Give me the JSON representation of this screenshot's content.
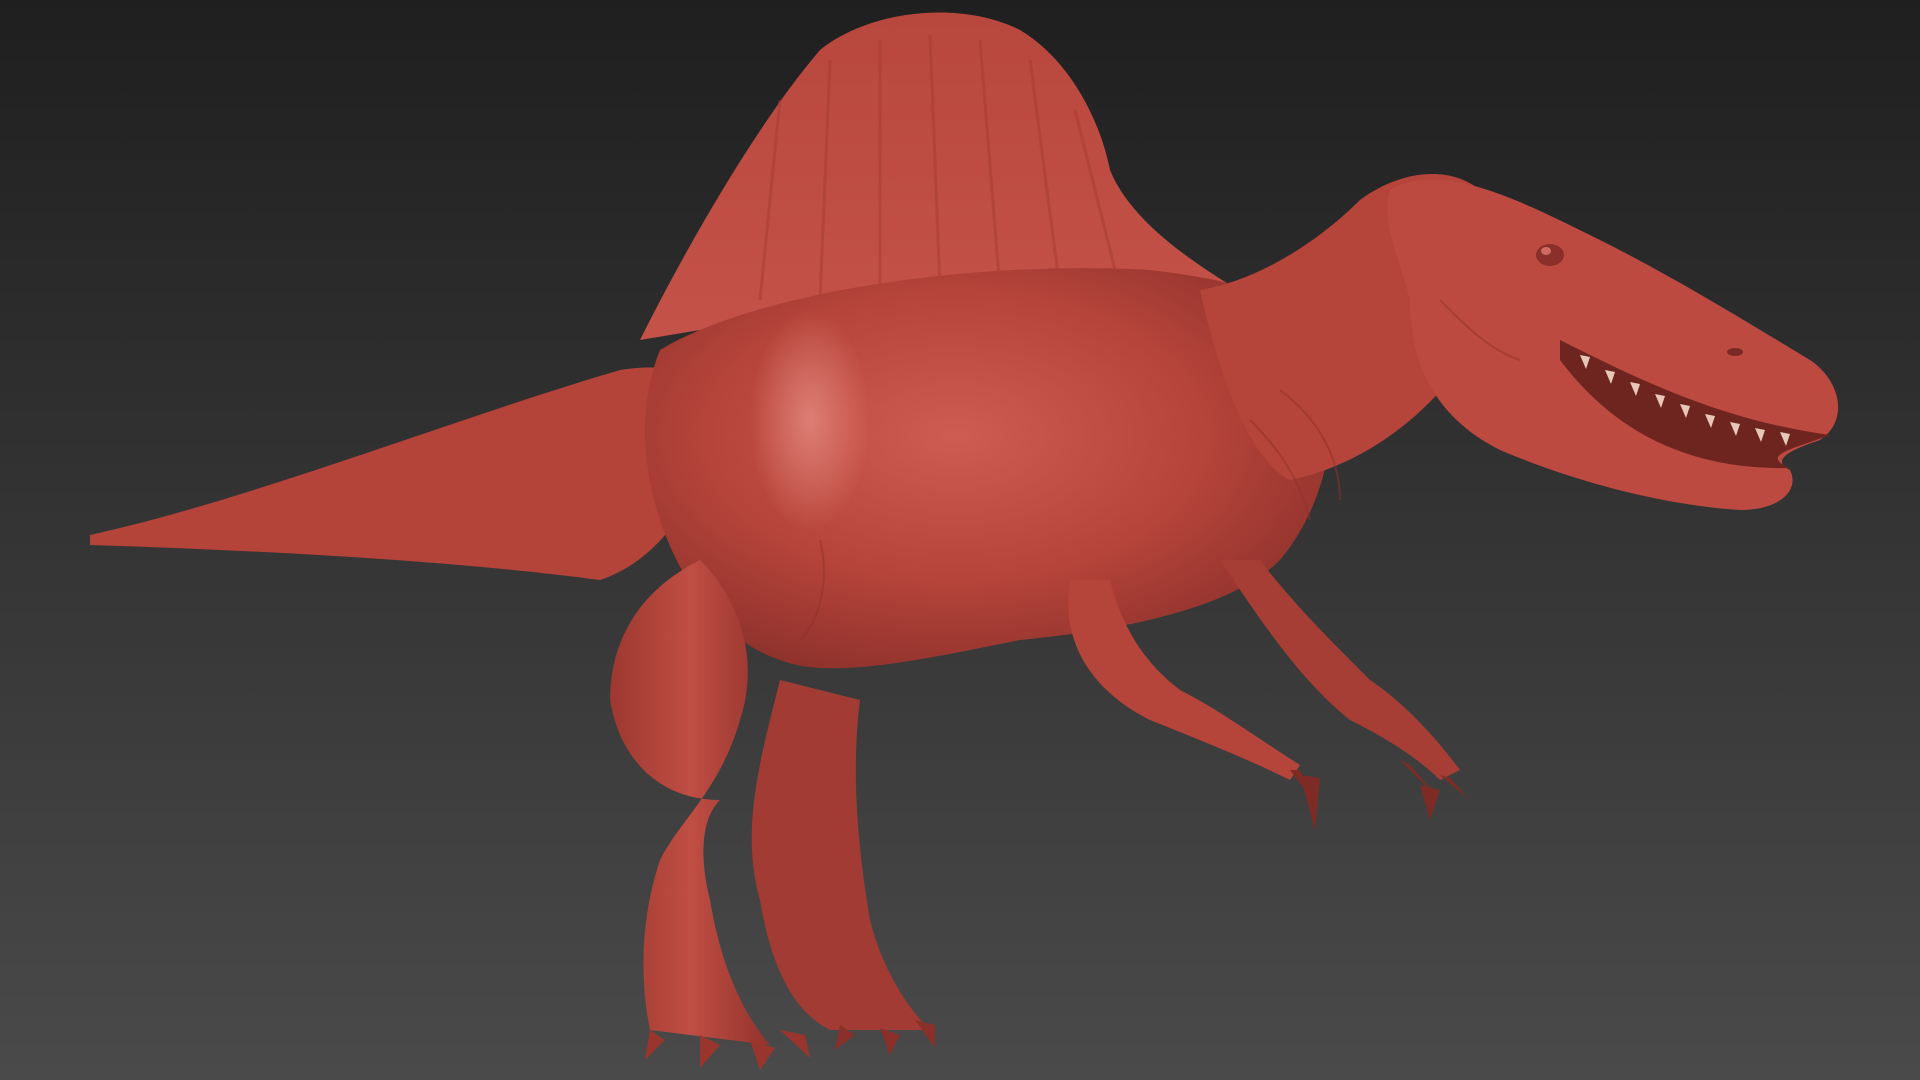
{
  "scene": {
    "subject_icon": "spinosaurus-sculpt-icon",
    "background_top_color": "#1f1f1f",
    "background_bottom_color": "#4a4a4a",
    "model_base_color": "#b9463d",
    "model_highlight_color": "#d8746a",
    "model_shadow_color": "#7a2a24",
    "text": []
  }
}
